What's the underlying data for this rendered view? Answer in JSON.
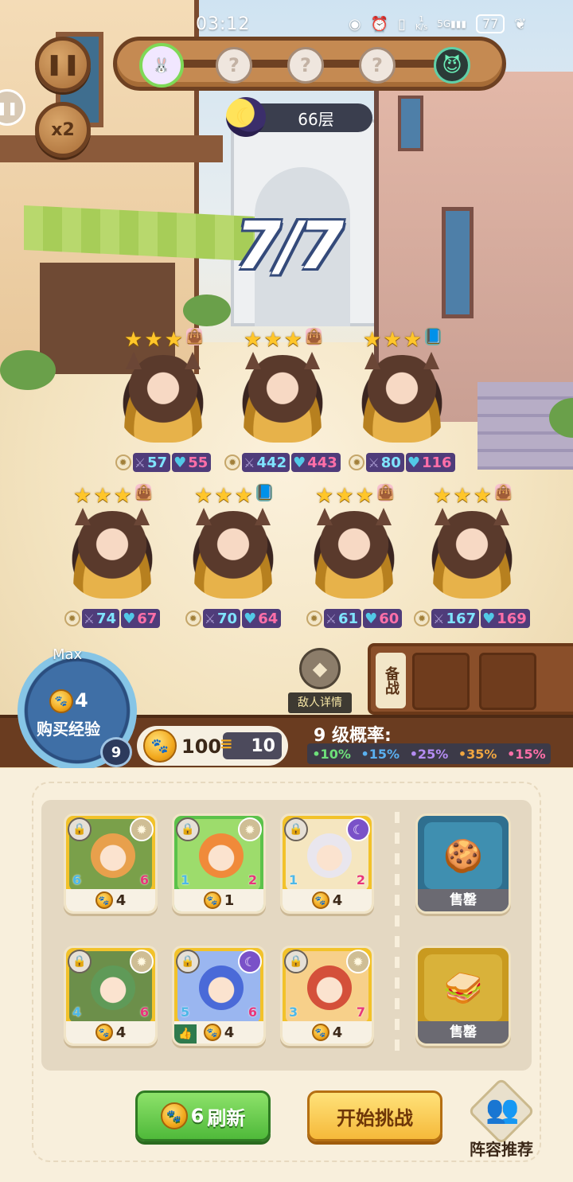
{
  "status_bar": {
    "time": "03:12",
    "net_speed": "1\nK/s",
    "signal": "5G",
    "battery": "77"
  },
  "controls": {
    "pause_icon": "❚❚",
    "speed_icon": "x2",
    "edge_icon": "❚❚"
  },
  "progress": {
    "stages": [
      {
        "type": "current",
        "label": "🐰"
      },
      {
        "type": "unknown",
        "label": "?"
      },
      {
        "type": "unknown",
        "label": "?"
      },
      {
        "type": "unknown",
        "label": "?"
      },
      {
        "type": "boss",
        "label": "😈"
      }
    ]
  },
  "floor": {
    "label": "66层"
  },
  "wave": {
    "text": "7/7"
  },
  "enemies": [
    {
      "stars": 3,
      "item": "bag",
      "atk": "57",
      "hp": "55"
    },
    {
      "stars": 3,
      "item": "bag",
      "atk": "442",
      "hp": "443"
    },
    {
      "stars": 3,
      "item": "book",
      "atk": "80",
      "hp": "116"
    },
    {
      "stars": 3,
      "item": "bag",
      "atk": "74",
      "hp": "67"
    },
    {
      "stars": 3,
      "item": "book",
      "atk": "70",
      "hp": "64"
    },
    {
      "stars": 3,
      "item": "bag",
      "atk": "61",
      "hp": "60"
    },
    {
      "stars": 3,
      "item": "bag",
      "atk": "167",
      "hp": "169"
    }
  ],
  "enemy_detail": {
    "label": "敌人详情"
  },
  "bench": {
    "label": "备战"
  },
  "experience": {
    "max_label": "Max",
    "cost": "4",
    "label": "购买经验",
    "level": "9"
  },
  "gold": {
    "amount": "100",
    "income": "10"
  },
  "probability": {
    "title": "9 级概率:",
    "rates": [
      {
        "text": "•10%",
        "color": "#6ee07a"
      },
      {
        "text": "•15%",
        "color": "#5ab0f0"
      },
      {
        "text": "•25%",
        "color": "#b48cf2"
      },
      {
        "text": "•35%",
        "color": "#f0a640"
      },
      {
        "text": "•15%",
        "color": "#ff6fa8"
      }
    ]
  },
  "shop": {
    "heroes": [
      {
        "class": "sun",
        "atk": "6",
        "hp": "6",
        "cost": "4",
        "frame": "#f2c22a",
        "art": "#7aa04a",
        "face": "#e8a04c"
      },
      {
        "class": "sun",
        "atk": "1",
        "hp": "2",
        "cost": "1",
        "frame": "#5bc24a",
        "art": "#9ddc6c",
        "face": "#f08a3a"
      },
      {
        "class": "moon",
        "atk": "1",
        "hp": "2",
        "cost": "4",
        "frame": "#f2c22a",
        "art": "#f5e6c0",
        "face": "#e9e6ee"
      },
      {
        "class": "sun",
        "atk": "4",
        "hp": "6",
        "cost": "4",
        "frame": "#f2c22a",
        "art": "#6c8f4a",
        "face": "#5f9a58"
      },
      {
        "class": "moon",
        "atk": "5",
        "hp": "6",
        "cost": "4",
        "frame": "#f2c22a",
        "art": "#9ab6f0",
        "face": "#4a6ad8"
      },
      {
        "class": "sun",
        "atk": "3",
        "hp": "7",
        "cost": "4",
        "frame": "#f2c22a",
        "art": "#f7d08a",
        "face": "#d4503a"
      }
    ],
    "items": [
      {
        "label": "售罄",
        "icon": "🍪",
        "frame": "#2f6f8f",
        "art": "#3f8fb0"
      },
      {
        "label": "售罄",
        "icon": "🥪",
        "frame": "#c99a1f",
        "art": "#d9b23a"
      }
    ],
    "refresh_cost": "6",
    "refresh_label": "刷新",
    "challenge_label": "开始挑战",
    "lineup_label": "阵容推荐"
  },
  "icons": {
    "lock": "🔒",
    "sun": "✹",
    "moon": "☾",
    "star": "★",
    "bag": "👜",
    "book": "📘",
    "atk": "⚔",
    "hp": "♥",
    "coin": "●",
    "thumb": "👍",
    "book_detail": "◆",
    "lineup": "👥"
  }
}
